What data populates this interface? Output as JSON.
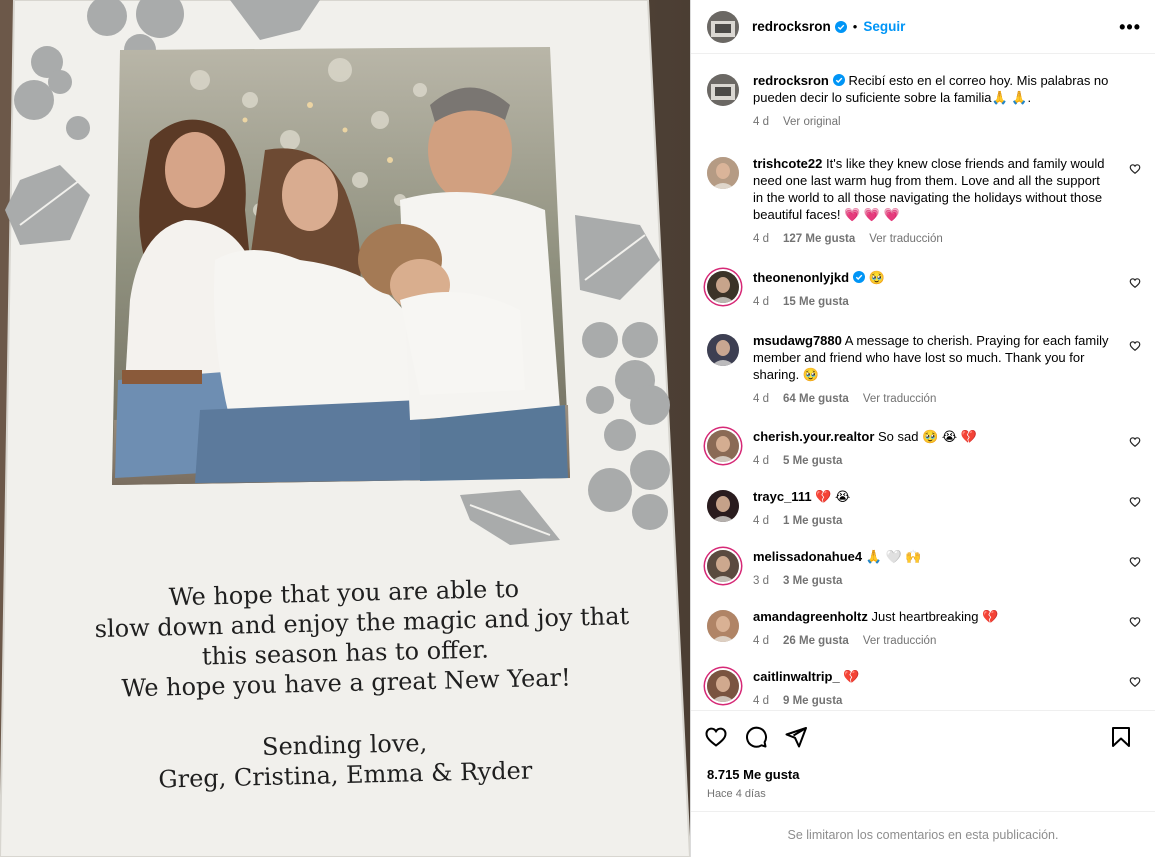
{
  "post": {
    "username": "redrocksron",
    "follow_label": "Seguir",
    "dot": "•",
    "more_label": "•••"
  },
  "card": {
    "message_lines": [
      "We hope that you are able to",
      "slow down and enjoy the magic and joy that",
      "this season has to offer.",
      "We hope you have a great New Year!"
    ],
    "sign_lines": [
      "Sending love,",
      "Greg, Cristina, Emma & Ryder"
    ]
  },
  "caption": {
    "user": "redrocksron",
    "text": "Recibí esto en el correo hoy. Mis palabras no pueden decir lo suficiente sobre la familia🙏 🙏.",
    "time": "4 d",
    "see_original": "Ver original"
  },
  "comments": [
    {
      "user": "trishcote22",
      "text": "It's like they knew close friends and family would need one last warm hug from them. Love and all the support in the world to all those navigating the holidays without those beautiful faces! 💗 💗 💗",
      "time": "4 d",
      "likes": "127 Me gusta",
      "translate": "Ver traducción",
      "avatar_color": "#b59b84"
    },
    {
      "user": "theonenonlyjkd",
      "verified": true,
      "text": "🥹",
      "time": "4 d",
      "likes": "15 Me gusta",
      "translate": "",
      "avatar_color": "#3b3328",
      "ring": true
    },
    {
      "user": "msudawg7880",
      "text": "A message to cherish. Praying for each family member and friend who have lost so much. Thank you for sharing. 🥹",
      "time": "4 d",
      "likes": "64 Me gusta",
      "translate": "Ver traducción",
      "avatar_color": "#3d3f52"
    },
    {
      "user": "cherish.your.realtor",
      "text": "So sad 🥹 😭 💔",
      "time": "4 d",
      "likes": "5 Me gusta",
      "translate": "",
      "avatar_color": "#8a6a55",
      "ring": true
    },
    {
      "user": "trayc_111",
      "text": "💔 😭",
      "time": "4 d",
      "likes": "1 Me gusta",
      "translate": "",
      "avatar_color": "#2a1c1e"
    },
    {
      "user": "melissadonahue4",
      "text": "🙏 🤍 🙌",
      "time": "3 d",
      "likes": "3 Me gusta",
      "translate": "",
      "avatar_color": "#5a4a3f",
      "ring": true
    },
    {
      "user": "amandagreenholtz",
      "text": "Just heartbreaking 💔",
      "time": "4 d",
      "likes": "26 Me gusta",
      "translate": "Ver traducción",
      "avatar_color": "#b08466"
    },
    {
      "user": "caitlinwaltrip_",
      "text": "💔",
      "time": "4 d",
      "likes": "9 Me gusta",
      "translate": "",
      "avatar_color": "#7a5440",
      "ring": true
    }
  ],
  "actions": {
    "likes": "8.715 Me gusta",
    "ago": "Hace 4 días"
  },
  "footer": "Se limitaron los comentarios en esta publicación.",
  "colors": {
    "accent": "#0095f6",
    "ring": "#d62976",
    "muted": "#737373"
  },
  "icons": [
    "verified-icon",
    "more-icon",
    "heart-icon",
    "comment-icon",
    "share-icon",
    "bookmark-icon"
  ]
}
